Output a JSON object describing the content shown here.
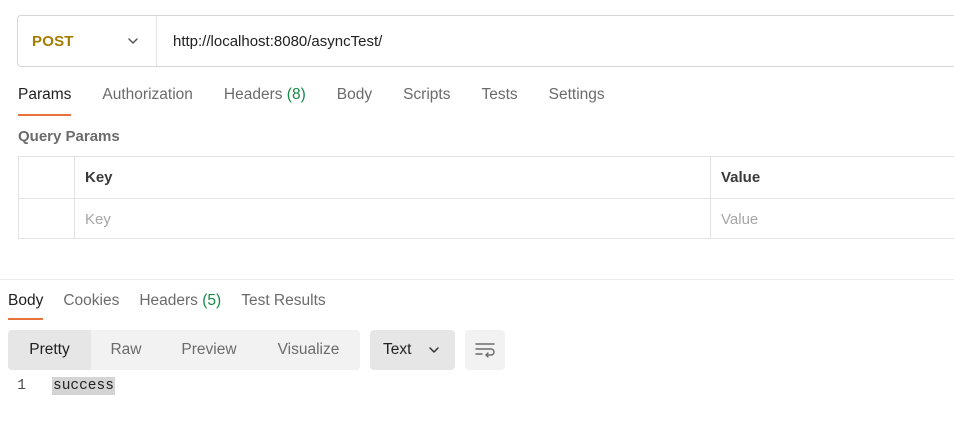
{
  "request": {
    "method": "POST",
    "url": "http://localhost:8080/asyncTest/"
  },
  "request_tabs": [
    {
      "label": "Params",
      "active": true
    },
    {
      "label": "Authorization"
    },
    {
      "label": "Headers",
      "count": "(8)"
    },
    {
      "label": "Body"
    },
    {
      "label": "Scripts"
    },
    {
      "label": "Tests"
    },
    {
      "label": "Settings"
    }
  ],
  "query_params": {
    "title": "Query Params",
    "col_key": "Key",
    "col_value": "Value",
    "key_placeholder": "Key",
    "value_placeholder": "Value"
  },
  "response_tabs": [
    {
      "label": "Body",
      "active": true
    },
    {
      "label": "Cookies"
    },
    {
      "label": "Headers",
      "count": "(5)"
    },
    {
      "label": "Test Results"
    }
  ],
  "view_modes": [
    "Pretty",
    "Raw",
    "Preview",
    "Visualize"
  ],
  "format": "Text",
  "body_lines": [
    {
      "line": "1",
      "text": "success"
    }
  ],
  "colors": {
    "method": "#a37c00",
    "active_tab_underline": "#e8733a",
    "count": "#168a46"
  },
  "icons": {
    "method_dropdown": "chevron-down-icon",
    "format_dropdown": "chevron-down-icon",
    "wrap": "wrap-lines-icon"
  }
}
